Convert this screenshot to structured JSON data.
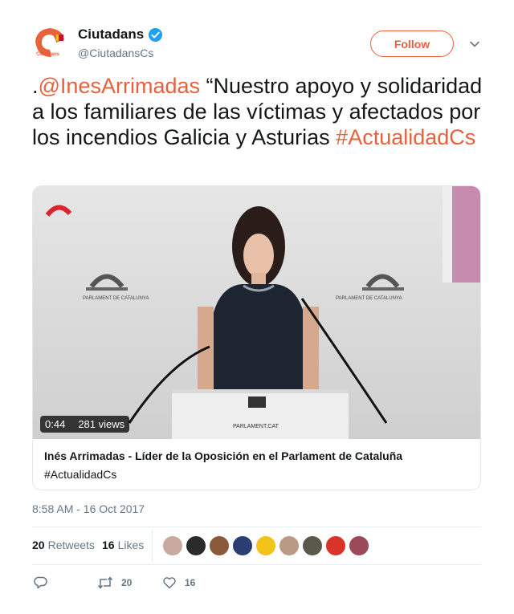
{
  "user": {
    "name": "Ciutadans",
    "handle": "@CiutadansCs",
    "avatar_text": "Cs",
    "avatar_subtext": "Ciutadans"
  },
  "follow_label": "Follow",
  "tweet": {
    "prefix": ".",
    "mention": "@InesArrimadas",
    "body": " “Nuestro apoyo y solidaridad a los familiares de las víctimas y afectados por los incendios Galicia y Asturias ",
    "hashtag": "#ActualidadCs"
  },
  "media": {
    "duration": "0:44",
    "views": "281 views",
    "podium_text": "PARLAMENT.CAT",
    "backdrop_text": "PARLAMENT DE CATALUNYA",
    "title": "Inés Arrimadas - Líder de la Oposición en el Parlament de Cataluña",
    "description": "#ActualidadCs"
  },
  "timestamp": "8:58 AM - 16 Oct 2017",
  "stats": {
    "retweets_count": "20",
    "retweets_label": "Retweets",
    "likes_count": "16",
    "likes_label": "Likes"
  },
  "actions": {
    "retweet_count": "20",
    "like_count": "16"
  },
  "colors": {
    "accent": "#e7623c",
    "verified": "#1da1f2",
    "muted": "#657786"
  },
  "likers": [
    {
      "color": "#c7a9a0"
    },
    {
      "color": "#2b2b2b"
    },
    {
      "color": "#8a5a3a"
    },
    {
      "color": "#2c3e70"
    },
    {
      "color": "#f2c318"
    },
    {
      "color": "#b89a85"
    },
    {
      "color": "#5a5a4a"
    },
    {
      "color": "#d8342a"
    },
    {
      "color": "#9c4a5a"
    }
  ]
}
